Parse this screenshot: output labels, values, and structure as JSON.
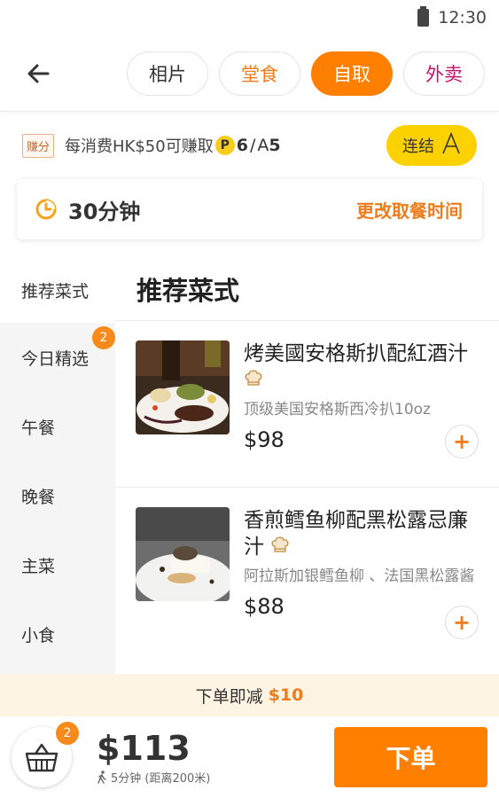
{
  "status_bar": {
    "time": "12:30"
  },
  "header": {
    "tabs": [
      {
        "label": "相片"
      },
      {
        "label": "堂食"
      },
      {
        "label": "自取"
      },
      {
        "label": "外卖"
      }
    ]
  },
  "earn": {
    "badge": "赚分",
    "text": "每消费HK$50可赚取",
    "points_icon": "P",
    "points": "6",
    "slash": "/",
    "asia_icon": "A",
    "asia_points": "5",
    "link_label": "连结"
  },
  "pickup": {
    "minutes": "30分钟",
    "change_label": "更改取餐时间"
  },
  "sidebar": {
    "items": [
      {
        "label": "推荐菜式"
      },
      {
        "label": "今日精选",
        "badge": "2"
      },
      {
        "label": "午餐"
      },
      {
        "label": "晚餐"
      },
      {
        "label": "主菜"
      },
      {
        "label": "小食"
      }
    ]
  },
  "menu": {
    "section_title": "推荐菜式",
    "dishes": [
      {
        "name": "烤美國安格斯扒配紅酒汁",
        "desc": "顶级美国安格斯西冷扒10oz",
        "price": "$98",
        "add": "+"
      },
      {
        "name": "香煎鳕鱼柳配黑松露忌廉汁",
        "desc": "阿拉斯加银鳕鱼柳 、法国黑松露酱",
        "price": "$88",
        "add": "+"
      }
    ]
  },
  "promo": {
    "text": "下单即减",
    "amount": "$10"
  },
  "footer": {
    "cart_count": "2",
    "total": "$113",
    "walk_text": "5分钟 (距离200米)",
    "order_label": "下单"
  },
  "colors": {
    "accent": "#ff7f00",
    "dinein": "#f07b1a",
    "delivery": "#c8106c",
    "link_yellow": "#fcd100",
    "promo_bg": "#fdf4e3"
  }
}
